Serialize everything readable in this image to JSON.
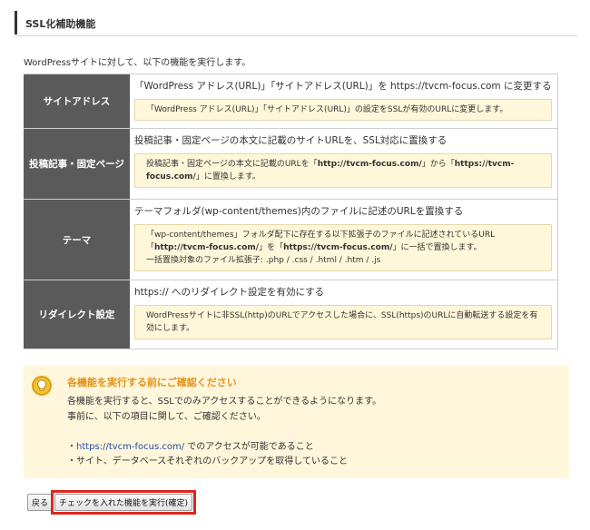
{
  "header": {
    "title": "SSL化補助機能"
  },
  "intro": "WordPressサイトに対して、以下の機能を実行します。",
  "rows": [
    {
      "label": "サイトアドレス",
      "title": "「WordPress アドレス(URL)」「サイトアドレス(URL)」を https://tvcm-focus.com に変更する",
      "note_lines": [
        "「WordPress アドレス(URL)」「サイトアドレス(URL)」の設定をSSLが有効のURLに変更します。"
      ]
    },
    {
      "label": "投稿記事・固定ページ",
      "title": "投稿記事・固定ページの本文に記載のサイトURLを、SSL対応に置換する",
      "note_pre": "投稿記事・固定ページの本文に記載のURLを「",
      "note_b1": "http://tvcm-focus.com/",
      "note_mid": "」から「",
      "note_b2": "https://tvcm-focus.com/",
      "note_post": "」に置換します。"
    },
    {
      "label": "テーマ",
      "title": "テーマフォルダ(wp-content/themes)内のファイルに記述のURLを置換する",
      "note_pre": "「wp-content/themes」フォルダ配下に存在する以下拡張子のファイルに記述されているURL「",
      "note_b1": "http://tvcm-focus.com/",
      "note_mid": "」を「",
      "note_b2": "https://tvcm-focus.com/",
      "note_post": "」に一括で置換します。",
      "note_extra": "一括置換対象のファイル拡張子: .php / .css / .html / .htm / .js"
    },
    {
      "label": "リダイレクト設定",
      "title": "https:// へのリダイレクト設定を有効にする",
      "note_lines": [
        "WordPressサイトに非SSL(http)のURLでアクセスした場合に、SSL(https)のURLに自動転送する設定を有効にします。"
      ]
    }
  ],
  "notice": {
    "title": "各機能を実行する前にご確認ください",
    "line1": "各機能を実行すると、SSLでのみアクセスすることができるようになります。",
    "line2": "事前に、以下の項目に関して、ご確認ください。",
    "bullet1_prefix": "・",
    "bullet1_link": "https://tvcm-focus.com/",
    "bullet1_suffix": " でのアクセスが可能であること",
    "bullet2": "・サイト、データベースそれぞれのバックアップを取得していること"
  },
  "buttons": {
    "back_label": "戻る",
    "execute_label": "チェックを入れた機能を実行(確定)"
  },
  "colors": {
    "label_bg": "#5a5a5a",
    "note_bg": "#fff7d9",
    "notice_bg": "#fff6db",
    "notice_title": "#e39317",
    "highlight": "#e0261b",
    "link": "#1f4fa8"
  }
}
